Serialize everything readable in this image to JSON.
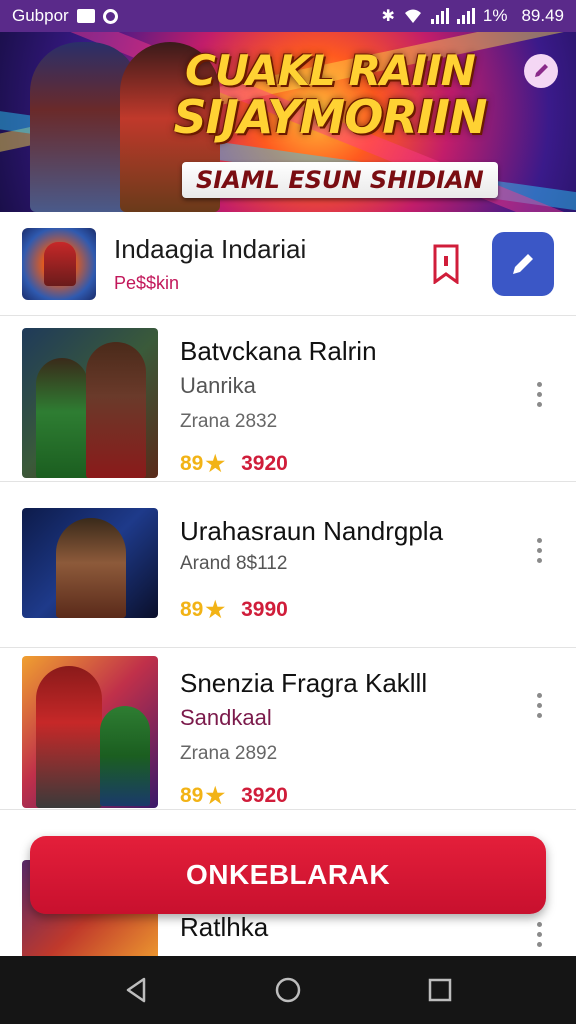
{
  "status_bar": {
    "carrier": "Gubpor",
    "icons": [
      "image-icon",
      "circle-icon",
      "bluetooth-icon",
      "wifi-icon",
      "signal-icon",
      "signal-icon"
    ],
    "battery": "1%",
    "time": "89.49"
  },
  "hero": {
    "title_line1": "CUAKL RAIIN",
    "title_line2": "SIJAYMORIIN",
    "subtitle": "SIAML ESUN SHIDIAN",
    "edit_icon": "edit-icon"
  },
  "app_header": {
    "title": "Indaagia Indariai",
    "subtitle": "Pe$$kin",
    "bookmark_icon": "bookmark-icon",
    "edit_button_icon": "pencil-icon",
    "accent": "#3b57c6"
  },
  "list": {
    "items": [
      {
        "name": "Batvckana Ralrin",
        "developer": "Uanrika",
        "date": "Zrana 2832",
        "rating": "89",
        "count": "3920"
      },
      {
        "name": "Urahasraun Nandrgpla",
        "developer": "Arand 8$112",
        "date": "",
        "rating": "89",
        "count": "3990"
      },
      {
        "name": "Snenzia Fragra Kaklll",
        "developer": "Sandkaal",
        "date": "Zrana 2892",
        "rating": "89",
        "count": "3920"
      },
      {
        "name": "Ratlhka",
        "developer": "",
        "date": "",
        "rating": "",
        "count": ""
      }
    ]
  },
  "fab": {
    "label": "ONKEBLARAK",
    "color": "#d41633"
  },
  "nav": {
    "back_icon": "back-triangle-icon",
    "home_icon": "home-circle-icon",
    "recents_icon": "recents-square-icon"
  }
}
